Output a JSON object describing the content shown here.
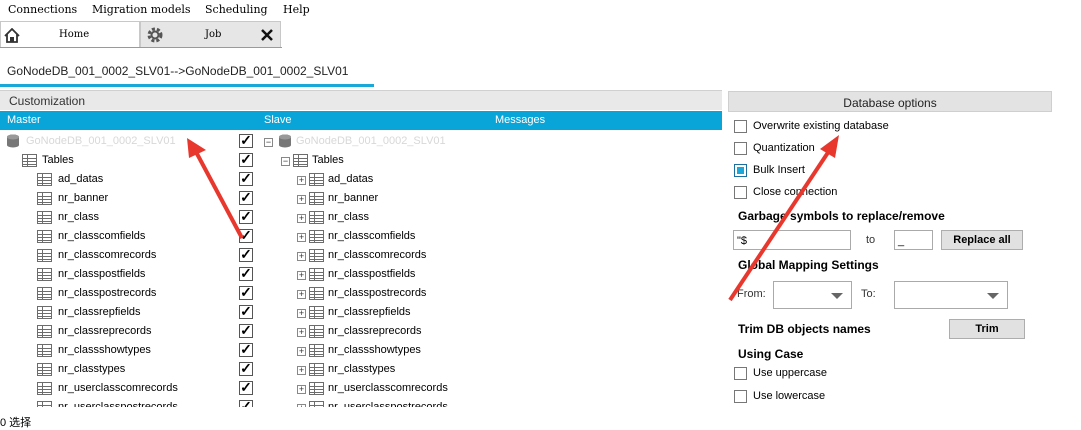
{
  "menu": [
    "Connections",
    "Migration models",
    "Scheduling",
    "Help"
  ],
  "tabs": {
    "home": "Home",
    "job": "Job"
  },
  "breadcrumb": "GoNodeDB_001_0002_SLV01-->GoNodeDB_001_0002_SLV01",
  "customization_title": "Customization",
  "grid_headers": {
    "master": "Master",
    "slave": "Slave",
    "messages": "Messages"
  },
  "master_db": "GoNodeDB_001_0002_SLV01",
  "slave_db": "GoNodeDB_001_0002_SLV01",
  "tables_label": "Tables",
  "tables": [
    "ad_datas",
    "nr_banner",
    "nr_class",
    "nr_classcomfields",
    "nr_classcomrecords",
    "nr_classpostfields",
    "nr_classpostrecords",
    "nr_classrepfields",
    "nr_classreprecords",
    "nr_classshowtypes",
    "nr_classtypes",
    "nr_userclasscomrecords",
    "nr_userclasspostrecords"
  ],
  "db_options": {
    "title": "Database options",
    "overwrite": "Overwrite existing database",
    "quantization": "Quantization",
    "bulk_insert": "Bulk Insert",
    "close_connection": "Close connection",
    "garbage_title": "Garbage symbols to replace/remove",
    "garbage_value": "\"$",
    "to_label": "to",
    "to_value": "_",
    "replace_all": "Replace all",
    "global_mapping": "Global Mapping Settings",
    "from_label": "From:",
    "to_label2": "To:",
    "trim_title": "Trim DB objects names",
    "trim_button": "Trim",
    "using_case": "Using Case",
    "uppercase": "Use uppercase",
    "lowercase": "Use lowercase"
  },
  "footer_text": "0 选择",
  "colors": {
    "accent": "#0aa5d8",
    "arrow": "#e8382e"
  },
  "checked": {
    "bulk_insert": true
  }
}
